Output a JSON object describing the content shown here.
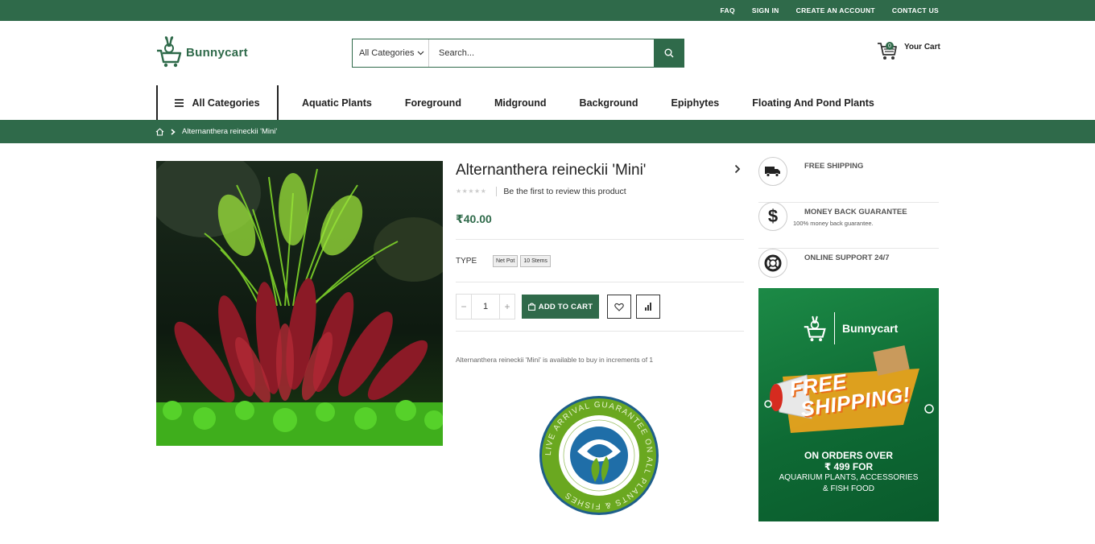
{
  "topbar": {
    "links": [
      "FAQ",
      "SIGN IN",
      "CREATE AN ACCOUNT",
      "CONTACT US"
    ]
  },
  "header": {
    "logo_text": "Bunnycart",
    "search": {
      "category": "All Categories",
      "placeholder": "Search..."
    },
    "cart": {
      "label": "Your Cart",
      "count": "0"
    }
  },
  "nav": {
    "all_categories": "All Categories",
    "items": [
      "Aquatic Plants",
      "Foreground",
      "Midground",
      "Background",
      "Epiphytes",
      "Floating And Pond Plants"
    ]
  },
  "breadcrumb": {
    "current": "Alternanthera reineckii 'Mini'"
  },
  "product": {
    "title": "Alternanthera reineckii 'Mini'",
    "stars": "★★★★★",
    "review_text": "Be the first to review this product",
    "price": "₹40.00",
    "type_label": "TYPE",
    "options": [
      "Net Pot",
      "10 Stems"
    ],
    "qty_minus": "−",
    "quantity": "1",
    "qty_plus": "+",
    "add_to_cart": "ADD TO CART",
    "availability": "Alternanthera reineckii 'Mini' is available to buy in increments of 1"
  },
  "seal": {
    "outer_text": "LIVE ARRIVAL GUARANTEE ON ALL PLANTS & FISHES"
  },
  "services": [
    {
      "title": "FREE SHIPPING",
      "icon": "truck-icon"
    },
    {
      "title": "MONEY BACK GUARANTEE",
      "subtitle": "100% money back guarantee.",
      "icon": "dollar-icon"
    },
    {
      "title": "ONLINE SUPPORT 24/7",
      "icon": "lifebuoy-icon"
    }
  ],
  "banner": {
    "logo_text": "Bunnycart",
    "headline_1": "FREE",
    "headline_2": "SHIPPING!",
    "line1": "ON ORDERS OVER",
    "line2": "₹ 499 FOR",
    "line3": "AQUARIUM PLANTS, ACCESSORIES",
    "line4": "& FISH FOOD"
  },
  "colors": {
    "brand_green": "#2f6a4a",
    "banner_green": "#0e6a34",
    "accent_orange": "#e96b1b"
  }
}
